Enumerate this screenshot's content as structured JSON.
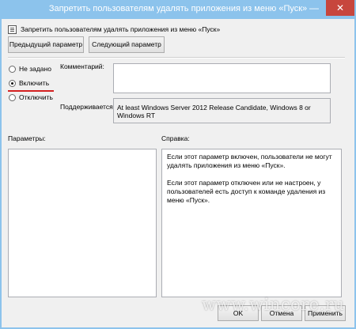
{
  "window": {
    "title": "Запретить пользователям удалять приложения из меню «Пуск»",
    "minimize_glyph": "—",
    "close_glyph": "✕"
  },
  "header": {
    "title": "Запретить пользователям удалять приложения из меню «Пуск»",
    "prev_button": "Предыдущий параметр",
    "next_button": "Следующий параметр"
  },
  "state": {
    "options": [
      "Не задано",
      "Включить",
      "Отключить"
    ],
    "selected": "Включить"
  },
  "form": {
    "comment_label": "Комментарий:",
    "comment_value": "",
    "supported_label": "Поддерживается:",
    "supported_value": "At least Windows Server 2012 Release Candidate, Windows 8 or Windows RT"
  },
  "panes": {
    "params_label": "Параметры:",
    "help_label": "Справка:",
    "help_paragraphs": [
      "Если этот параметр включен, пользователи не могут удалять приложения из меню «Пуск».",
      "Если этот параметр отключен или не настроен, у пользователей есть доступ к команде удаления из меню «Пуск»."
    ]
  },
  "footer": {
    "ok": "OK",
    "cancel": "Отмена",
    "apply": "Применить"
  },
  "watermark": "www.wincore.ru",
  "colors": {
    "frame": "#8cc3ec",
    "close_button": "#c7463d",
    "highlight_mark": "#d42020"
  }
}
